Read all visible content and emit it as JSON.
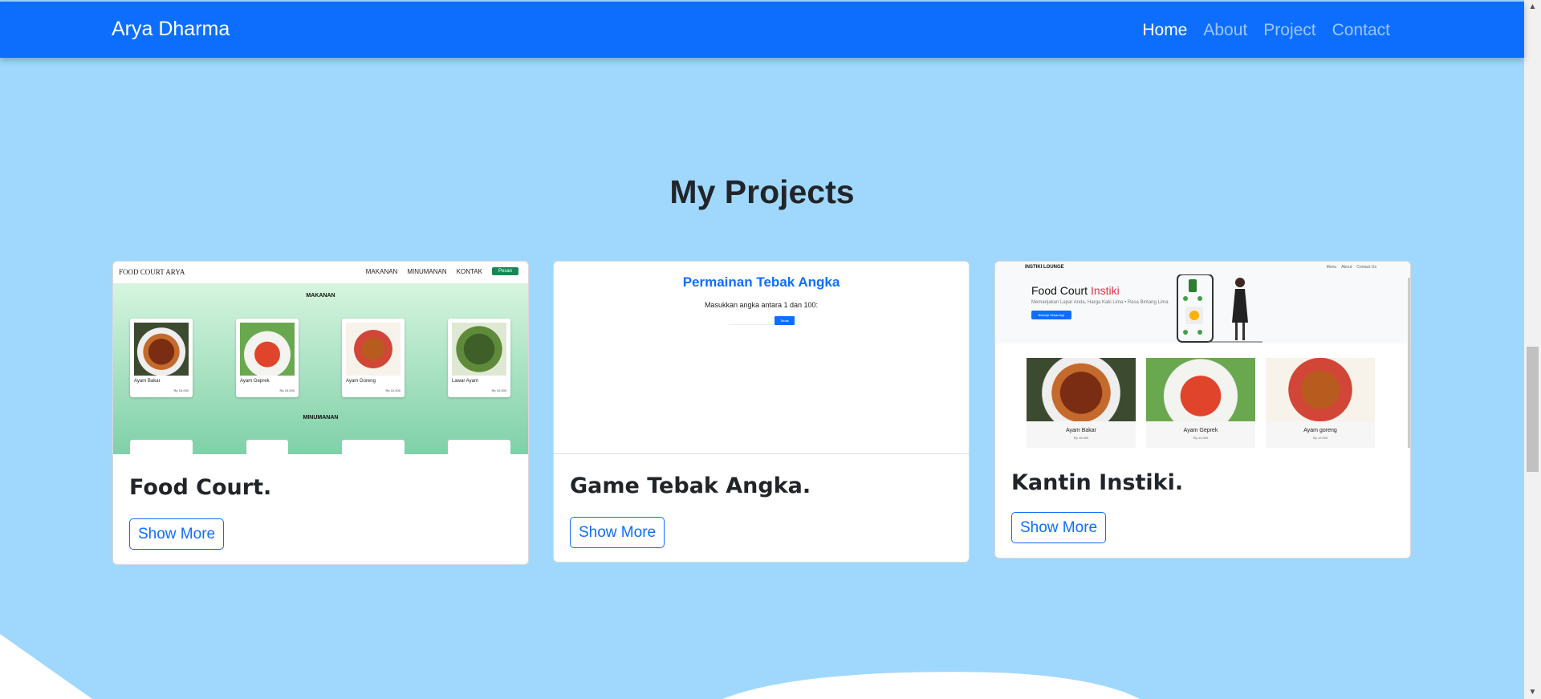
{
  "navbar": {
    "brand": "Arya Dharma",
    "links": [
      "Home",
      "About",
      "Project",
      "Contact"
    ]
  },
  "projects": {
    "title": "My Projects",
    "cards": [
      {
        "title": "Food Court.",
        "button": "Show More",
        "preview": {
          "brand": "FOOD COURT ARYA",
          "nav": [
            "MAKANAN",
            "MINUMANAN",
            "KONTAK"
          ],
          "nav_button": "Pesan",
          "section_food": "MAKANAN",
          "section_drink": "MINUMANAN",
          "items": [
            {
              "name": "Ayam Bakar",
              "price": "Rp 15.000"
            },
            {
              "name": "Ayam Geprek",
              "price": "Rp 15.000"
            },
            {
              "name": "Ayam Goreng",
              "price": "Rp 12.000"
            },
            {
              "name": "Lawar Ayam",
              "price": "Rp 10.000"
            }
          ]
        }
      },
      {
        "title": "Game Tebak Angka.",
        "button": "Show More",
        "preview": {
          "title": "Permainan Tebak Angka",
          "subtitle": "Masukkan angka antara 1 dan 100:",
          "button": "Tebak"
        }
      },
      {
        "title": "Kantin Instiki.",
        "button": "Show More",
        "preview": {
          "brand": "INSTIKI LOUNGE",
          "nav": [
            "Menu",
            "About",
            "Contact Us"
          ],
          "hero_title": "Food Court",
          "hero_title_accent": "Instiki",
          "hero_sub": "Memanjakan Lapar Anda, Harga Kaki Lima • Rasa Bintang Lima",
          "hero_button": "Belanja Sekarang!",
          "items": [
            {
              "name": "Ayam Bakar",
              "price": "Rp 15.000"
            },
            {
              "name": "Ayam Geprek",
              "price": "Rp 12.000"
            },
            {
              "name": "Ayam goreng",
              "price": "Rp 12.000"
            }
          ]
        }
      }
    ]
  },
  "colors": {
    "navbar": "#0d6efd",
    "background": "#a0d8fd",
    "button_border": "#0d6efd"
  }
}
